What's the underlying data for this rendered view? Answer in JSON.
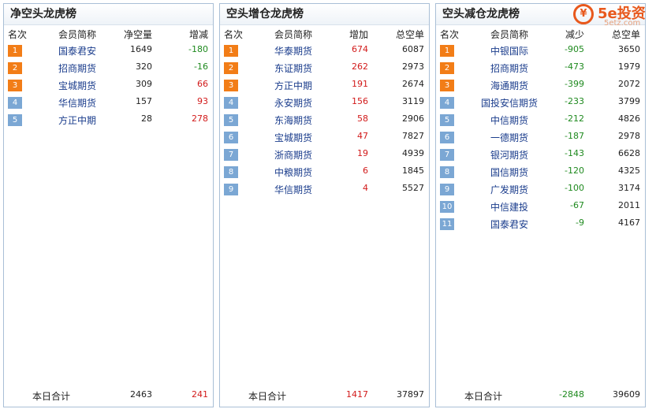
{
  "logo": {
    "icon": "¥",
    "main": "5e投资",
    "sub": "5etz.com"
  },
  "panels": [
    {
      "title": "净空头龙虎榜",
      "headers": [
        "名次",
        "会员简称",
        "净空量",
        "增减"
      ],
      "rows": [
        {
          "rank": "1",
          "name": "国泰君安",
          "v1": "1649",
          "v2": "-180",
          "v2c": "green"
        },
        {
          "rank": "2",
          "name": "招商期货",
          "v1": "320",
          "v2": "-16",
          "v2c": "green"
        },
        {
          "rank": "3",
          "name": "宝城期货",
          "v1": "309",
          "v2": "66",
          "v2c": "red"
        },
        {
          "rank": "4",
          "name": "华信期货",
          "v1": "157",
          "v2": "93",
          "v2c": "red"
        },
        {
          "rank": "5",
          "name": "方正中期",
          "v1": "28",
          "v2": "278",
          "v2c": "red"
        }
      ],
      "footer": {
        "label": "本日合计",
        "v1": "2463",
        "v2": "241",
        "v1c": "",
        "v2c": "red"
      }
    },
    {
      "title": "空头增仓龙虎榜",
      "headers": [
        "名次",
        "会员简称",
        "增加",
        "总空单"
      ],
      "rows": [
        {
          "rank": "1",
          "name": "华泰期货",
          "v1": "674",
          "v2": "6087",
          "v1c": "red"
        },
        {
          "rank": "2",
          "name": "东证期货",
          "v1": "262",
          "v2": "2973",
          "v1c": "red"
        },
        {
          "rank": "3",
          "name": "方正中期",
          "v1": "191",
          "v2": "2674",
          "v1c": "red"
        },
        {
          "rank": "4",
          "name": "永安期货",
          "v1": "156",
          "v2": "3119",
          "v1c": "red"
        },
        {
          "rank": "5",
          "name": "东海期货",
          "v1": "58",
          "v2": "2906",
          "v1c": "red"
        },
        {
          "rank": "6",
          "name": "宝城期货",
          "v1": "47",
          "v2": "7827",
          "v1c": "red"
        },
        {
          "rank": "7",
          "name": "浙商期货",
          "v1": "19",
          "v2": "4939",
          "v1c": "red"
        },
        {
          "rank": "8",
          "name": "中粮期货",
          "v1": "6",
          "v2": "1845",
          "v1c": "red"
        },
        {
          "rank": "9",
          "name": "华信期货",
          "v1": "4",
          "v2": "5527",
          "v1c": "red"
        }
      ],
      "footer": {
        "label": "本日合计",
        "v1": "1417",
        "v2": "37897",
        "v1c": "red",
        "v2c": ""
      }
    },
    {
      "title": "空头减仓龙虎榜",
      "headers": [
        "名次",
        "会员简称",
        "减少",
        "总空单"
      ],
      "rows": [
        {
          "rank": "1",
          "name": "中银国际",
          "v1": "-905",
          "v2": "3650",
          "v1c": "green"
        },
        {
          "rank": "2",
          "name": "招商期货",
          "v1": "-473",
          "v2": "1979",
          "v1c": "green"
        },
        {
          "rank": "3",
          "name": "海通期货",
          "v1": "-399",
          "v2": "2072",
          "v1c": "green"
        },
        {
          "rank": "4",
          "name": "国投安信期货",
          "v1": "-233",
          "v2": "3799",
          "v1c": "green"
        },
        {
          "rank": "5",
          "name": "中信期货",
          "v1": "-212",
          "v2": "4826",
          "v1c": "green"
        },
        {
          "rank": "6",
          "name": "一德期货",
          "v1": "-187",
          "v2": "2978",
          "v1c": "green"
        },
        {
          "rank": "7",
          "name": "银河期货",
          "v1": "-143",
          "v2": "6628",
          "v1c": "green"
        },
        {
          "rank": "8",
          "name": "国信期货",
          "v1": "-120",
          "v2": "4325",
          "v1c": "green"
        },
        {
          "rank": "9",
          "name": "广发期货",
          "v1": "-100",
          "v2": "3174",
          "v1c": "green"
        },
        {
          "rank": "10",
          "name": "中信建投",
          "v1": "-67",
          "v2": "2011",
          "v1c": "green"
        },
        {
          "rank": "11",
          "name": "国泰君安",
          "v1": "-9",
          "v2": "4167",
          "v1c": "green"
        }
      ],
      "footer": {
        "label": "本日合计",
        "v1": "-2848",
        "v2": "39609",
        "v1c": "green",
        "v2c": ""
      }
    }
  ],
  "colors": {
    "top_rank_badge": "#f27d17",
    "other_rank_badge": "#7ba7d4",
    "increase": "#d21a1a",
    "decrease": "#1f8a1f",
    "member_name": "#1a3c8c"
  }
}
